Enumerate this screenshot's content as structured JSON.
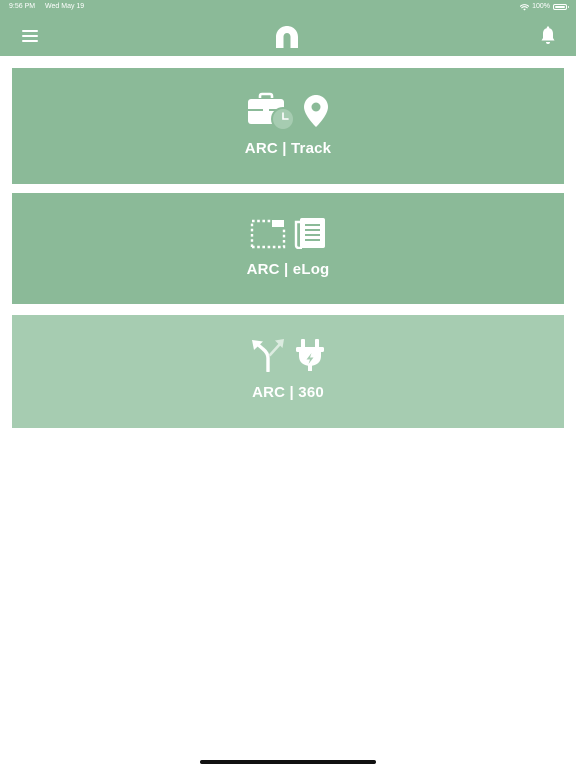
{
  "status_bar": {
    "time": "9:56 PM",
    "date": "Wed May 19",
    "battery_text": "100%",
    "battery_level": 1.0
  },
  "header": {
    "background_color": "#8bba98",
    "menu_icon": "hamburger-icon",
    "logo_icon": "arc-logo-icon",
    "notification_icon": "bell-icon"
  },
  "tiles": [
    {
      "label": "ARC | Track",
      "icons": [
        "briefcase-clock-icon",
        "location-pin-icon"
      ],
      "color": "#8bba98"
    },
    {
      "label": "ARC | eLog",
      "icons": [
        "dashed-folder-icon",
        "document-icon"
      ],
      "color": "#8bba98"
    },
    {
      "label": "ARC | 360",
      "icons": [
        "split-arrows-icon",
        "power-plug-icon"
      ],
      "color": "#a6ccb1"
    }
  ]
}
